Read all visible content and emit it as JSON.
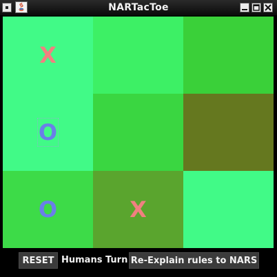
{
  "window": {
    "title": "NARTacToe"
  },
  "icons": {
    "system_menu": "system-menu-icon",
    "app": "java-coffee-cup-icon",
    "minimize": "minimize-icon",
    "maximize": "maximize-icon",
    "close": "close-icon"
  },
  "colors": {
    "mark_x": "#f08080",
    "mark_o": "#6a7fe8",
    "cell_bright": "#41fa87",
    "cell_medium": "#3df065",
    "cell_green": "#3ddb48",
    "cell_mid_green": "#3ad641",
    "cell_olive": "#65781f",
    "cell_dark_green": "#5aa52e"
  },
  "board": {
    "cells": [
      {
        "mark": "X",
        "color": "#41fa87"
      },
      {
        "mark": "",
        "color": "#3df065"
      },
      {
        "mark": "",
        "color": "#3ad039"
      },
      {
        "mark": "O",
        "color": "#41fa87",
        "focused": true
      },
      {
        "mark": "",
        "color": "#3ad641"
      },
      {
        "mark": "",
        "color": "#65781f"
      },
      {
        "mark": "O",
        "color": "#3ddb48"
      },
      {
        "mark": "X",
        "color": "#5aa52e"
      },
      {
        "mark": "",
        "color": "#41fa87"
      }
    ]
  },
  "controls": {
    "reset_label": "RESET",
    "status_text": "Humans Turn",
    "explain_label": "Re-Explain rules to NARS"
  }
}
